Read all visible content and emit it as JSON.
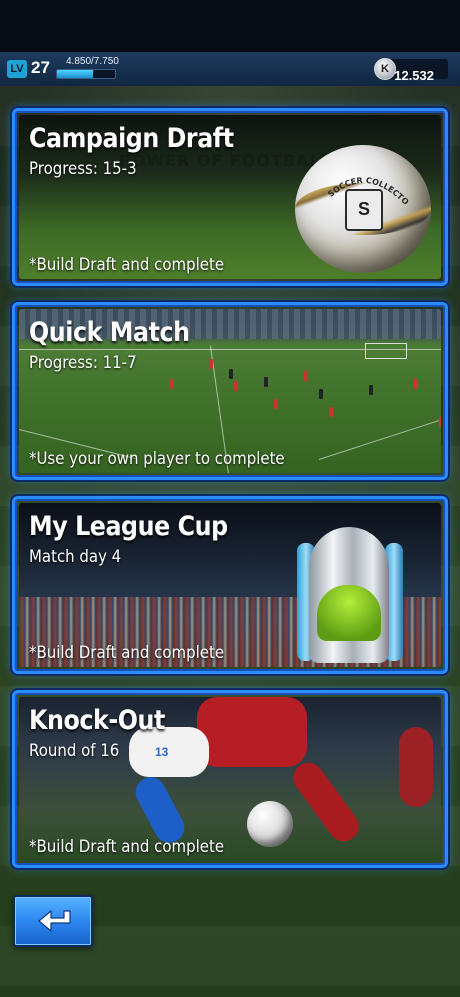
{
  "header": {
    "level_badge": "LV",
    "level": "27",
    "xp_text": "4.850/7.750",
    "xp_progress": 0.626,
    "coin_icon_letter": "K",
    "coins": "12.532"
  },
  "cards": [
    {
      "title": "Campaign Draft",
      "subtitle": "Progress: 15-3",
      "note": "*Build Draft and complete",
      "background_text": "POWER OF FOOTBALL",
      "ball_text": "SOCCER COLLECTOR",
      "ball_badge": "S"
    },
    {
      "title": "Quick Match",
      "subtitle": "Progress: 11-7",
      "note": "*Use your own player to complete"
    },
    {
      "title": "My League Cup",
      "subtitle": "Match day 4",
      "note": "*Build Draft and complete"
    },
    {
      "title": "Knock-Out",
      "subtitle": "Round of 16",
      "note": "*Build Draft and complete",
      "shirt_number": "13"
    }
  ],
  "back_button": {
    "icon": "back-arrow-icon"
  },
  "colors": {
    "card_border": "#2a8cff",
    "back_button": "#2e86f0",
    "xp_fill": "#4fd4ff"
  }
}
